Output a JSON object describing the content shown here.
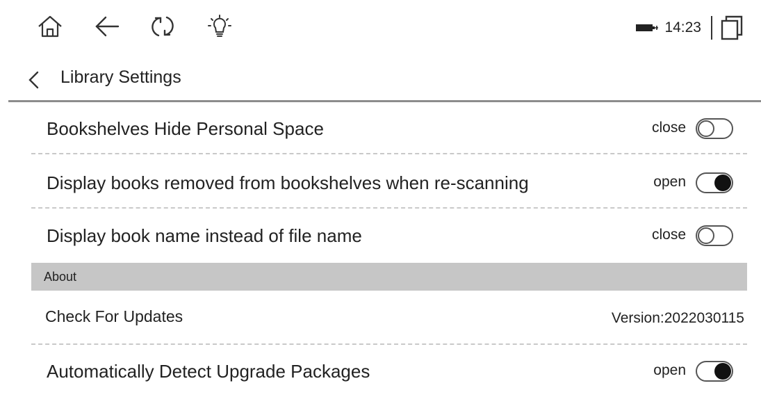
{
  "status_bar": {
    "icons": [
      "home-icon",
      "back-arrow-icon",
      "refresh-icon",
      "frontlight-icon"
    ],
    "battery_icon": "battery-charging-icon",
    "time": "14:23",
    "recents_icon": "recent-apps-icon"
  },
  "header": {
    "back_icon": "chevron-left-icon",
    "title": "Library Settings"
  },
  "settings": [
    {
      "label": "Bookshelves Hide Personal Space",
      "state": "close",
      "on": false
    },
    {
      "label": "Display books removed from bookshelves when re-scanning",
      "state": "open",
      "on": true
    },
    {
      "label": "Display book name instead of file name",
      "state": "close",
      "on": false
    }
  ],
  "about": {
    "section_title": "About",
    "check_updates": {
      "label": "Check For Updates",
      "version": "Version:2022030115"
    },
    "auto_detect": {
      "label": "Automatically Detect Upgrade Packages",
      "state": "open",
      "on": true
    }
  },
  "colors": {
    "section_bg": "#c6c6c6",
    "toggle_on": "#111111",
    "divider": "#c9c9c9"
  }
}
